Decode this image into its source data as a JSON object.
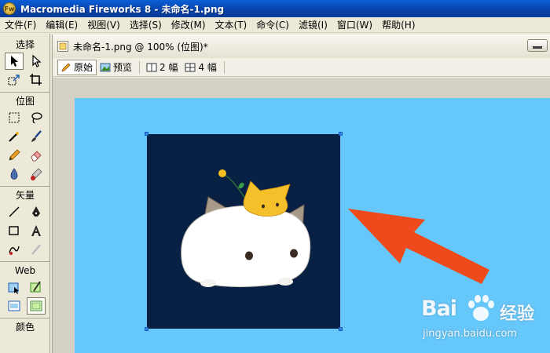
{
  "window": {
    "title": "Macromedia Fireworks 8 - 未命名-1.png",
    "app_icon_glyph": "Fw"
  },
  "menubar": {
    "items": [
      {
        "label": "文件(F)"
      },
      {
        "label": "编辑(E)"
      },
      {
        "label": "视图(V)"
      },
      {
        "label": "选择(S)"
      },
      {
        "label": "修改(M)"
      },
      {
        "label": "文本(T)"
      },
      {
        "label": "命令(C)"
      },
      {
        "label": "滤镜(I)"
      },
      {
        "label": "窗口(W)"
      },
      {
        "label": "帮助(H)"
      }
    ]
  },
  "tools": {
    "sections": [
      {
        "title": "选择",
        "tools": [
          "pointer-icon",
          "subselect-icon",
          "scale-icon",
          "crop-icon"
        ]
      },
      {
        "title": "位图",
        "tools": [
          "marquee-icon",
          "lasso-icon",
          "magic-wand-icon",
          "brush-icon",
          "pencil-icon",
          "eraser-icon",
          "blur-icon",
          "rubber-stamp-icon"
        ]
      },
      {
        "title": "矢量",
        "tools": [
          "line-icon",
          "pen-icon",
          "rectangle-icon",
          "text-icon",
          "freeform-icon",
          "knife-icon"
        ]
      },
      {
        "title": "Web",
        "tools": [
          "hotspot-icon",
          "slice-icon",
          "hide-slices-icon",
          "show-slices-icon"
        ]
      },
      {
        "title": "颜色",
        "tools": []
      }
    ]
  },
  "document": {
    "title": "未命名-1.png @ 100% (位图)*",
    "view_tabs": [
      {
        "label": "原始",
        "icon": "pencil-icon",
        "active": true
      },
      {
        "label": "预览",
        "icon": "preview-icon",
        "active": false
      },
      {
        "label": "2 幅",
        "icon": "two-up-icon",
        "active": false
      },
      {
        "label": "4 幅",
        "icon": "four-up-icon",
        "active": false
      }
    ]
  },
  "colors": {
    "canvas_bg": "#66c7fa",
    "image_bg": "#082043",
    "arrow": "#ee4a1c",
    "selection_handle": "#2d86e8"
  },
  "watermark": {
    "logo": "Bai",
    "logo_suffix": "经验",
    "url": "jingyan.baidu.com"
  }
}
